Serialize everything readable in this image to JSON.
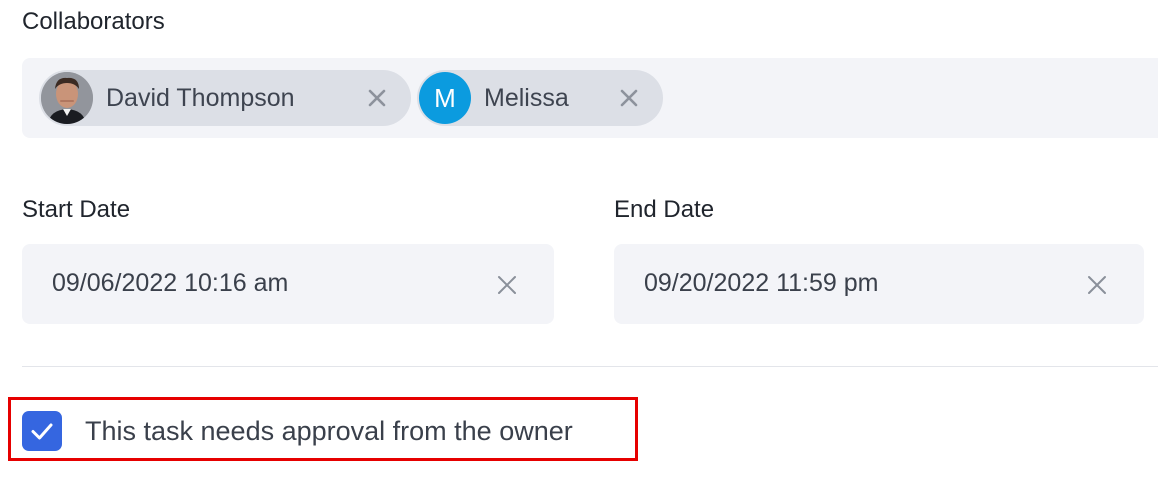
{
  "collaborators": {
    "label": "Collaborators",
    "chips": [
      {
        "name": "David Thompson",
        "avatar": "photo-avatar"
      },
      {
        "name": "Melissa",
        "avatar_letter": "M",
        "avatar_color": "#0b9bdf"
      }
    ]
  },
  "start_date": {
    "label": "Start Date",
    "value": "09/06/2022 10:16 am"
  },
  "end_date": {
    "label": "End Date",
    "value": "09/20/2022 11:59 pm"
  },
  "approval": {
    "checked": true,
    "label": "This task needs approval from the owner"
  },
  "colors": {
    "accent": "#3566e0",
    "highlight_border": "#e60000"
  }
}
